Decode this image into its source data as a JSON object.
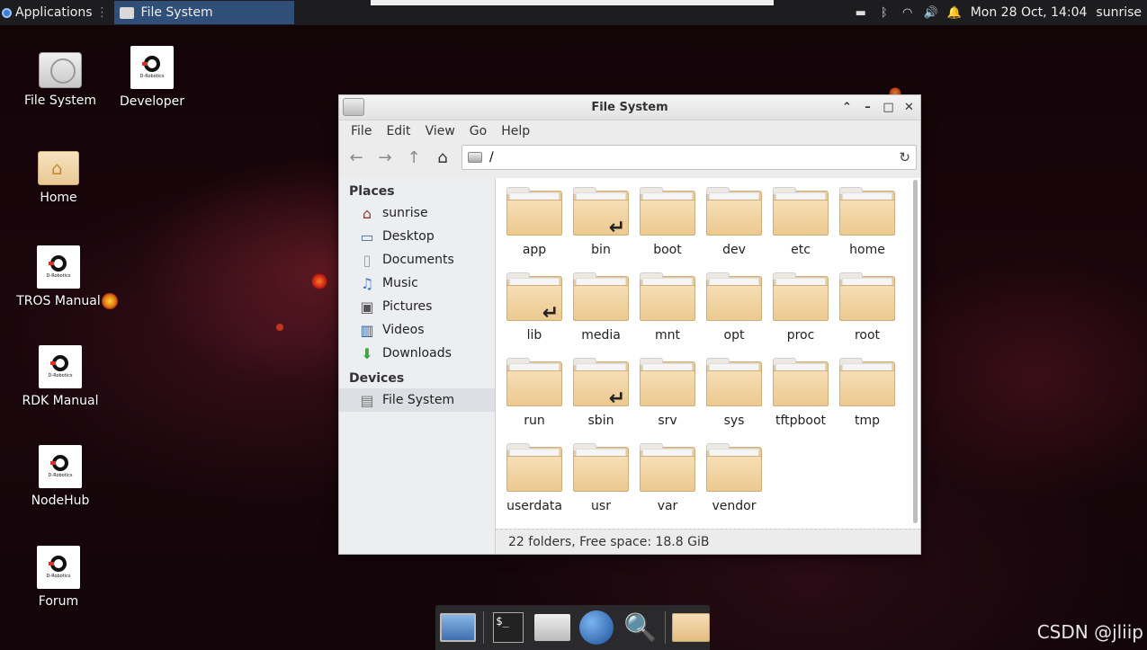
{
  "top_panel": {
    "applications_label": "Applications",
    "active_window_label": "File System",
    "clock": "Mon 28 Oct, 14:04",
    "username": "sunrise"
  },
  "desktop_icons": [
    {
      "label": "File System",
      "icon": "hard-drive-icon"
    },
    {
      "label": "Developer",
      "icon": "d-robotics-logo"
    },
    {
      "label": "Home",
      "icon": "home-folder-icon"
    },
    {
      "label": "TROS Manual",
      "icon": "d-robotics-logo"
    },
    {
      "label": "RDK Manual",
      "icon": "d-robotics-logo"
    },
    {
      "label": "NodeHub",
      "icon": "d-robotics-logo"
    },
    {
      "label": "Forum",
      "icon": "d-robotics-logo"
    }
  ],
  "logo_text": "D-Robotics",
  "window": {
    "title": "File System",
    "menu": [
      "File",
      "Edit",
      "View",
      "Go",
      "Help"
    ],
    "path": "/",
    "places_heading": "Places",
    "places": [
      {
        "label": "sunrise",
        "icon": "home-icon"
      },
      {
        "label": "Desktop",
        "icon": "desktop-icon"
      },
      {
        "label": "Documents",
        "icon": "document-icon"
      },
      {
        "label": "Music",
        "icon": "music-icon"
      },
      {
        "label": "Pictures",
        "icon": "pictures-icon"
      },
      {
        "label": "Videos",
        "icon": "videos-icon"
      },
      {
        "label": "Downloads",
        "icon": "download-icon"
      }
    ],
    "devices_heading": "Devices",
    "devices": [
      {
        "label": "File System",
        "icon": "hard-drive-icon"
      }
    ],
    "folders": [
      {
        "name": "app",
        "symlink": false
      },
      {
        "name": "bin",
        "symlink": true
      },
      {
        "name": "boot",
        "symlink": false
      },
      {
        "name": "dev",
        "symlink": false
      },
      {
        "name": "etc",
        "symlink": false
      },
      {
        "name": "home",
        "symlink": false
      },
      {
        "name": "lib",
        "symlink": true
      },
      {
        "name": "media",
        "symlink": false
      },
      {
        "name": "mnt",
        "symlink": false
      },
      {
        "name": "opt",
        "symlink": false
      },
      {
        "name": "proc",
        "symlink": false
      },
      {
        "name": "root",
        "symlink": false
      },
      {
        "name": "run",
        "symlink": false
      },
      {
        "name": "sbin",
        "symlink": true
      },
      {
        "name": "srv",
        "symlink": false
      },
      {
        "name": "sys",
        "symlink": false
      },
      {
        "name": "tftpboot",
        "symlink": false
      },
      {
        "name": "tmp",
        "symlink": false
      },
      {
        "name": "userdata",
        "symlink": false
      },
      {
        "name": "usr",
        "symlink": false
      },
      {
        "name": "var",
        "symlink": false
      },
      {
        "name": "vendor",
        "symlink": false
      }
    ],
    "status": "22 folders, Free space: 18.8 GiB"
  },
  "dock": {
    "terminal_prompt": "$_"
  },
  "watermark": "CSDN @jliip"
}
